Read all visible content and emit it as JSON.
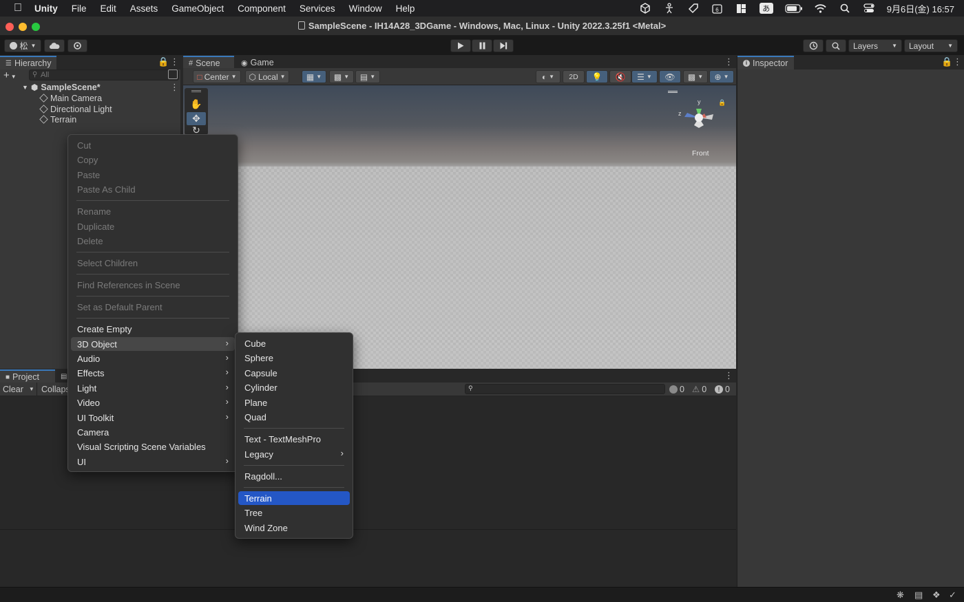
{
  "menubar": {
    "app": "Unity",
    "items": [
      "File",
      "Edit",
      "Assets",
      "GameObject",
      "Component",
      "Services",
      "Window",
      "Help"
    ],
    "ime": "あ",
    "clock": "9月6日(金)  16:57"
  },
  "window_title": "SampleScene - IH14A28_3DGame - Windows, Mac, Linux - Unity 2022.3.25f1 <Metal>",
  "toolbar": {
    "account_label": "松",
    "layers_label": "Layers",
    "layout_label": "Layout"
  },
  "hierarchy": {
    "tab": "Hierarchy",
    "search_placeholder": "All",
    "scene": "SampleScene*",
    "objects": [
      "Main Camera",
      "Directional Light",
      "Terrain"
    ]
  },
  "scene_tabs": {
    "scene": "Scene",
    "game": "Game"
  },
  "scene_toolbar": {
    "pivot": "Center",
    "space": "Local",
    "mode_2d": "2D"
  },
  "gizmo": {
    "axis_label": "Front",
    "y_label": "y",
    "z_label": "z"
  },
  "inspector": {
    "tab": "Inspector"
  },
  "bottom": {
    "project_tab": "Project",
    "clear_label": "Clear",
    "collapse_label": "Collapse",
    "log_count": "0",
    "warn_count": "0",
    "error_count": "0"
  },
  "context_menu": {
    "items": [
      {
        "label": "Cut",
        "enabled": false
      },
      {
        "label": "Copy",
        "enabled": false
      },
      {
        "label": "Paste",
        "enabled": false
      },
      {
        "label": "Paste As Child",
        "enabled": false
      },
      {
        "label": "Rename",
        "enabled": false
      },
      {
        "label": "Duplicate",
        "enabled": false
      },
      {
        "label": "Delete",
        "enabled": false
      },
      {
        "label": "Select Children",
        "enabled": false
      },
      {
        "label": "Find References in Scene",
        "enabled": false
      },
      {
        "label": "Set as Default Parent",
        "enabled": false
      },
      {
        "label": "Create Empty",
        "enabled": true
      },
      {
        "label": "3D Object",
        "enabled": true,
        "submenu": true
      },
      {
        "label": "Audio",
        "enabled": true,
        "submenu": true
      },
      {
        "label": "Effects",
        "enabled": true,
        "submenu": true
      },
      {
        "label": "Light",
        "enabled": true,
        "submenu": true
      },
      {
        "label": "Video",
        "enabled": true,
        "submenu": true
      },
      {
        "label": "UI Toolkit",
        "enabled": true,
        "submenu": true
      },
      {
        "label": "Camera",
        "enabled": true
      },
      {
        "label": "Visual Scripting Scene Variables",
        "enabled": true
      },
      {
        "label": "UI",
        "enabled": true,
        "submenu": true
      }
    ]
  },
  "submenu_3d": {
    "items": [
      {
        "label": "Cube"
      },
      {
        "label": "Sphere"
      },
      {
        "label": "Capsule"
      },
      {
        "label": "Cylinder"
      },
      {
        "label": "Plane"
      },
      {
        "label": "Quad"
      },
      {
        "label": "Text - TextMeshPro"
      },
      {
        "label": "Legacy",
        "submenu": true
      },
      {
        "label": "Ragdoll..."
      },
      {
        "label": "Terrain",
        "highlighted": true
      },
      {
        "label": "Tree"
      },
      {
        "label": "Wind Zone"
      }
    ]
  },
  "colors": {
    "highlight": "#2457c5",
    "tab_accent": "#3a79bb",
    "close": "#fe5f57",
    "minimize": "#febc2e",
    "zoom": "#28c840"
  }
}
